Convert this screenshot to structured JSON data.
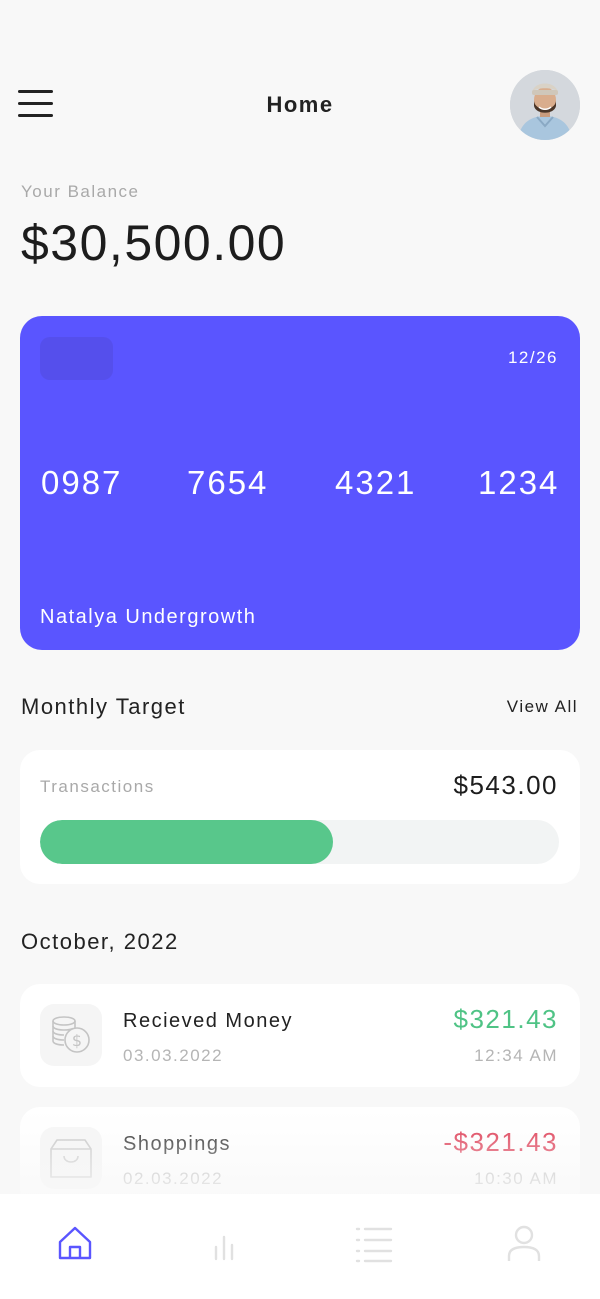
{
  "header": {
    "title": "Home",
    "menu_icon": "hamburger-menu-icon",
    "avatar_icon": "user-avatar"
  },
  "balance": {
    "label": "Your Balance",
    "value": "$30,500.00"
  },
  "card": {
    "color": "#5a55ff",
    "expiry": "12/26",
    "number_groups": [
      "0987",
      "7654",
      "4321",
      "1234"
    ],
    "holder": "Natalya Undergrowth"
  },
  "monthly_target": {
    "title": "Monthly Target",
    "view_all": "View All",
    "label": "Transactions",
    "amount": "$543.00",
    "progress_fraction": 0.565,
    "progress_color": "#58c78b"
  },
  "history": {
    "month": "October, 2022",
    "items": [
      {
        "icon": "coins-dollar-icon",
        "title": "Recieved Money",
        "date": "03.03.2022",
        "amount": "$321.43",
        "time": "12:34 AM",
        "amount_color": "#4fc385"
      },
      {
        "icon": "shopping-bag-icon",
        "title": "Shoppings",
        "date": "02.03.2022",
        "amount": "-$321.43",
        "time": "10:30 AM",
        "amount_color": "#dc2f49"
      }
    ]
  },
  "bottom_nav": {
    "active_color": "#5a55ff",
    "inactive_color": "#e1e1e1",
    "items": [
      {
        "icon": "home-icon",
        "active": true
      },
      {
        "icon": "bar-chart-icon",
        "active": false
      },
      {
        "icon": "list-icon",
        "active": false
      },
      {
        "icon": "profile-icon",
        "active": false
      }
    ]
  }
}
